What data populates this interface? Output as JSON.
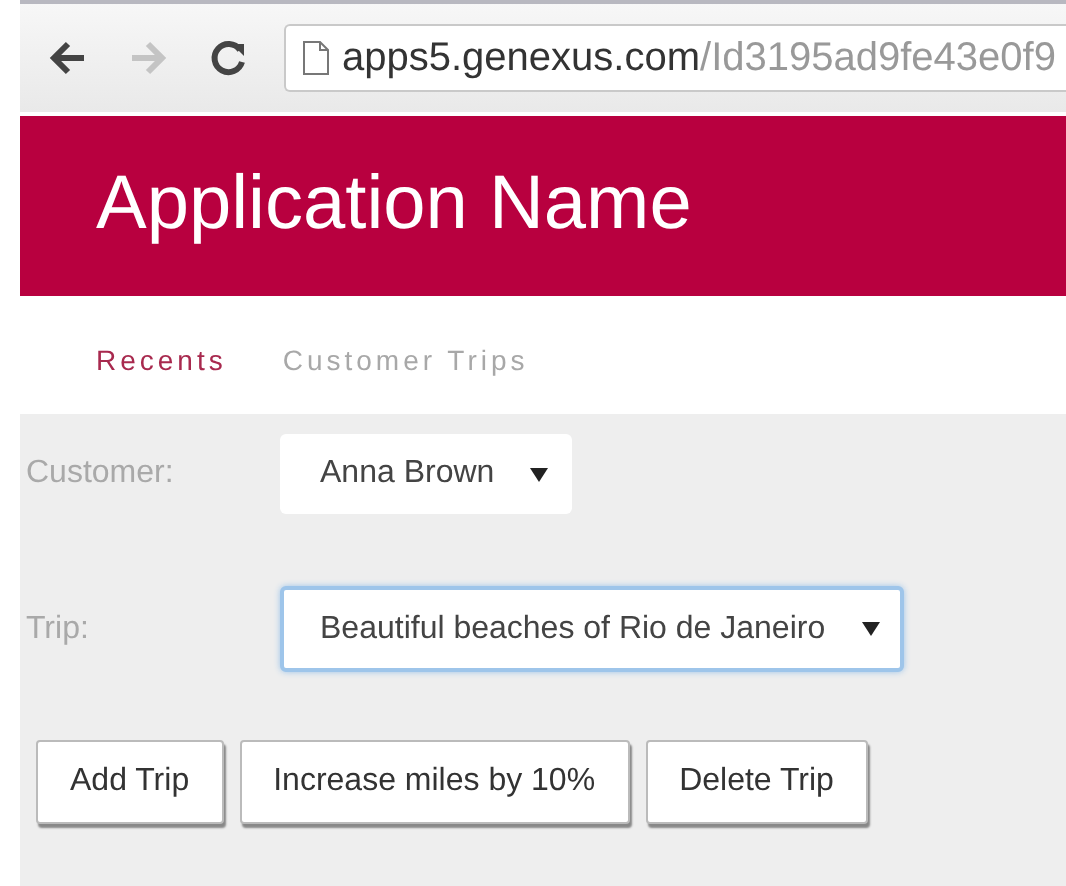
{
  "browser": {
    "nav_buttons": [
      {
        "kind": "back",
        "disabled": false
      },
      {
        "kind": "forward",
        "disabled": true
      },
      {
        "kind": "reload",
        "disabled": false
      }
    ],
    "address": {
      "host": "apps5.genexus.com",
      "path": "/Id3195ad9fe43e0f9"
    }
  },
  "header": {
    "title": "Application Name"
  },
  "tabs": [
    {
      "label": "Recents",
      "selected": true
    },
    {
      "label": "Customer Trips",
      "selected": false
    }
  ],
  "form": {
    "fields": [
      {
        "label": "Customer:",
        "value": "Anna Brown",
        "focused": false
      },
      {
        "label": "Trip:",
        "value": "Beautiful beaches of Rio de Janeiro",
        "focused": true
      }
    ]
  },
  "buttons": [
    "Add Trip",
    "Increase miles by 10%",
    "Delete Trip"
  ]
}
